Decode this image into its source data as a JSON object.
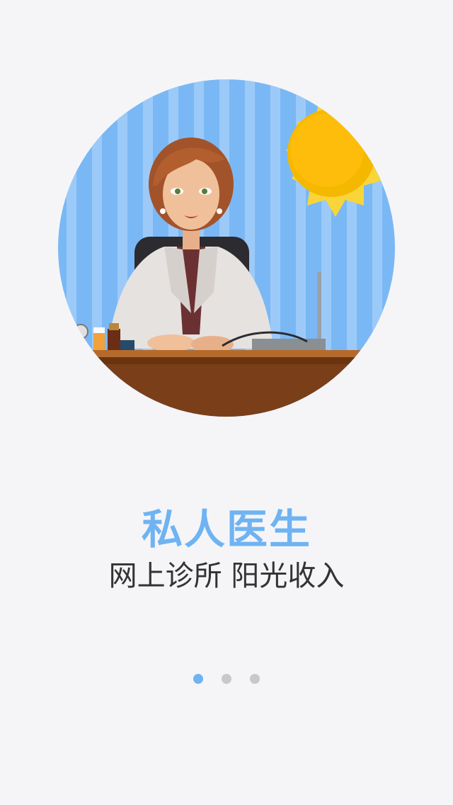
{
  "onboarding": {
    "title": "私人医生",
    "subtitle": "网上诊所 阳光收入",
    "illustration_icon": "doctor-at-desk-illustration",
    "colors": {
      "accent": "#6fb3f2",
      "subtitle": "#333333",
      "background": "#f5f5f8",
      "dot_inactive": "#c8c8cc"
    },
    "pager": {
      "total_pages": 3,
      "current_page": 1
    }
  }
}
